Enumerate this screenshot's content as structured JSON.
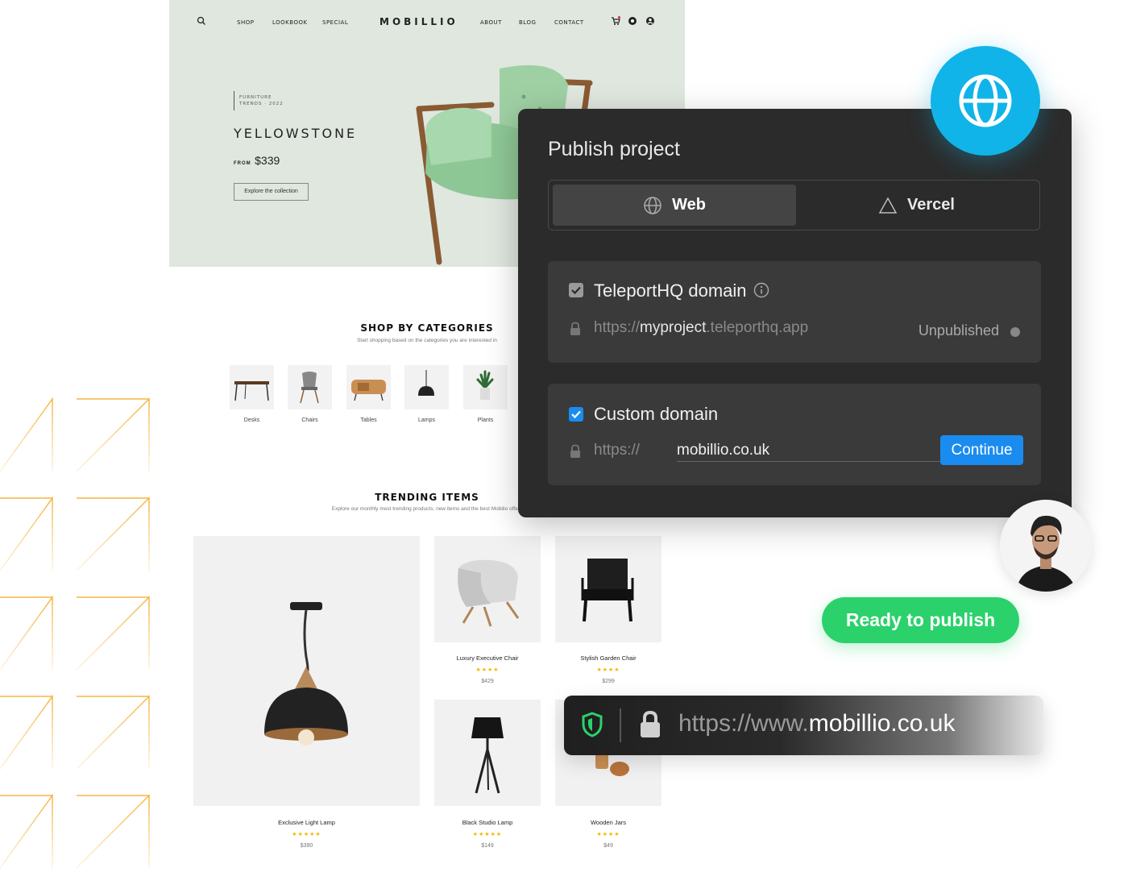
{
  "site": {
    "nav": {
      "left": [
        "SHOP",
        "LOOKBOOK",
        "SPECIAL"
      ],
      "logo": "MOBILLIO",
      "right": [
        "ABOUT",
        "BLOG",
        "CONTACT"
      ]
    },
    "hero": {
      "eyebrow_1": "FURNITURE",
      "eyebrow_2": "TRENDS · 2022",
      "title": "YELLOWSTONE",
      "price_from": "FROM",
      "price": "$339",
      "cta": "Explore the collection"
    },
    "categories": {
      "title": "SHOP BY CATEGORIES",
      "subtitle": "Start shopping based on the categories you are interested in",
      "items": [
        "Desks",
        "Chairs",
        "Tables",
        "Lamps",
        "Plants"
      ]
    },
    "trending": {
      "title": "TRENDING ITEMS",
      "subtitle": "Explore our monthly most trending products, new items and the best Mobilio offers",
      "products": [
        {
          "name": "Exclusive Light Lamp",
          "stars": "★★★★★",
          "price": "$390"
        },
        {
          "name": "Luxury Executive Chair",
          "stars": "★★★★",
          "price": "$429"
        },
        {
          "name": "Stylish Garden Chair",
          "stars": "★★★★",
          "price": "$299"
        },
        {
          "name": "Black Studio Lamp",
          "stars": "★★★★★",
          "price": "$149"
        },
        {
          "name": "Wooden Jars",
          "stars": "★★★★",
          "price": "$49"
        }
      ]
    }
  },
  "dialog": {
    "title": "Publish project",
    "tabs": {
      "web": "Web",
      "vercel": "Vercel"
    },
    "teleport": {
      "title": "TeleportHQ domain",
      "url_prefix": "https://",
      "url_name": "myproject",
      "url_suffix": ".teleporthq.app",
      "status": "Unpublished"
    },
    "custom": {
      "title": "Custom domain",
      "url_prefix": "https://",
      "value": "mobillio.co.uk",
      "button": "Continue"
    }
  },
  "badge": {
    "ready": "Ready to publish"
  },
  "address_bar": {
    "prefix": "https://www.",
    "domain": "mobillio.co.uk"
  },
  "colors": {
    "accent_blue": "#1a8cf0",
    "globe": "#11b4e8",
    "ready_green": "#2bd16b",
    "deco_orange": "#f5b642"
  }
}
